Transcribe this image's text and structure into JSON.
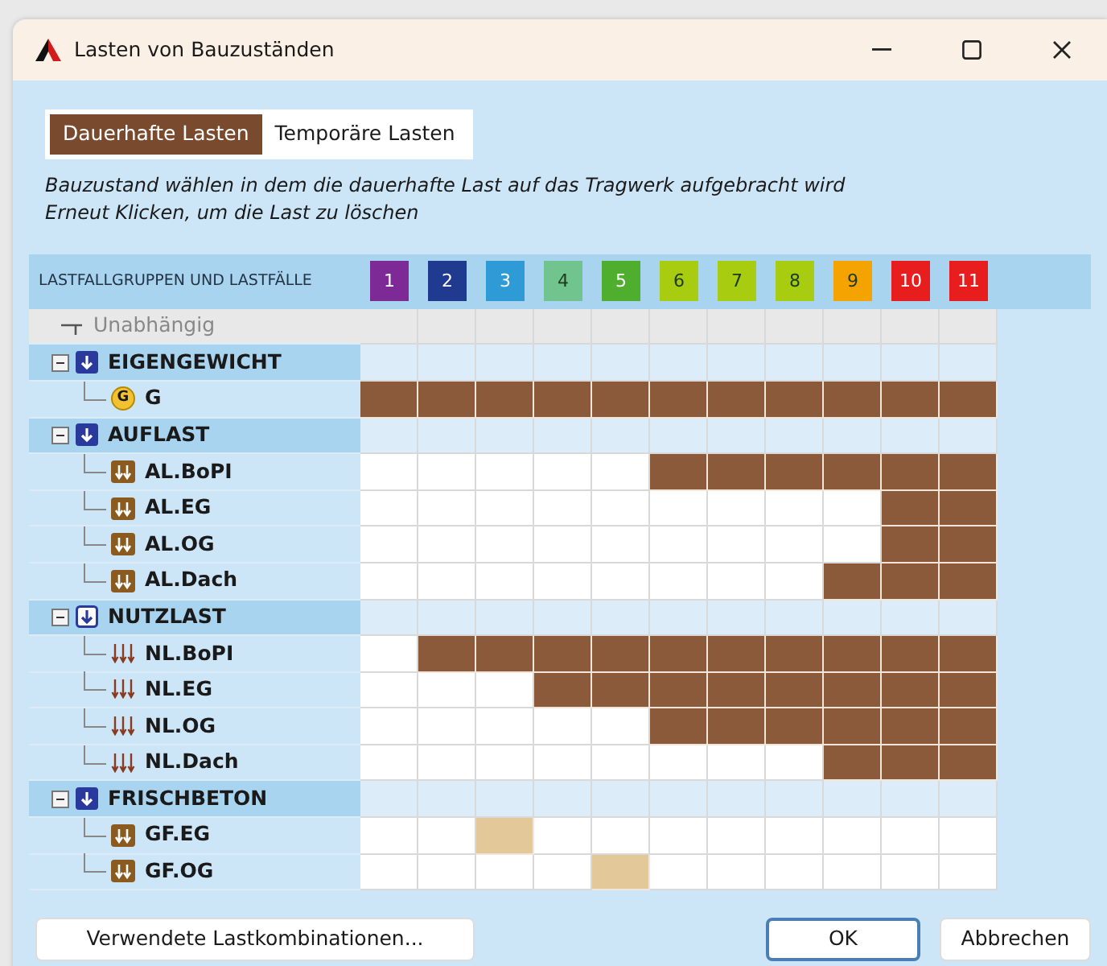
{
  "window": {
    "title": "Lasten von Bauzuständen"
  },
  "tabs": [
    {
      "label": "Dauerhafte Lasten",
      "selected": true
    },
    {
      "label": "Temporäre Lasten",
      "selected": false
    }
  ],
  "instructions": [
    "Bauzustand wählen in dem die dauerhafte Last auf das Tragwerk aufgebracht wird",
    "Erneut Klicken, um die Last zu löschen"
  ],
  "header_label": "LASTFALLGRUPPEN UND LASTFÄLLE",
  "load_cases": [
    {
      "label": "1",
      "color": "#7d2a96"
    },
    {
      "label": "2",
      "color": "#1f3a8f"
    },
    {
      "label": "3",
      "color": "#2e9bd6"
    },
    {
      "label": "4",
      "color": "#72c48e"
    },
    {
      "label": "5",
      "color": "#4fae2e"
    },
    {
      "label": "6",
      "color": "#a8cc10"
    },
    {
      "label": "7",
      "color": "#a8cc10"
    },
    {
      "label": "8",
      "color": "#a8cc10"
    },
    {
      "label": "9",
      "color": "#f5a300"
    },
    {
      "label": "10",
      "color": "#e81d1d"
    },
    {
      "label": "11",
      "color": "#e81d1d"
    }
  ],
  "tree": [
    {
      "label": "Unabhängig",
      "kind": "independent",
      "cells": [
        {
          "selected": false,
          "highlighted": false
        },
        {
          "selected": false,
          "highlighted": false
        },
        {
          "selected": false,
          "highlighted": false
        },
        {
          "selected": false,
          "highlighted": false
        },
        {
          "selected": false,
          "highlighted": false
        },
        {
          "selected": false,
          "highlighted": false
        },
        {
          "selected": false,
          "highlighted": false
        },
        {
          "selected": false,
          "highlighted": false
        },
        {
          "selected": false,
          "highlighted": false
        },
        {
          "selected": false,
          "highlighted": false
        },
        {
          "selected": false,
          "highlighted": false
        }
      ]
    },
    {
      "label": "EIGENGEWICHT",
      "kind": "permanent_group",
      "expanded": true,
      "cells": [
        {
          "selected": false,
          "highlighted": false
        },
        {
          "selected": false,
          "highlighted": false
        },
        {
          "selected": false,
          "highlighted": false
        },
        {
          "selected": false,
          "highlighted": false
        },
        {
          "selected": false,
          "highlighted": false
        },
        {
          "selected": false,
          "highlighted": false
        },
        {
          "selected": false,
          "highlighted": false
        },
        {
          "selected": false,
          "highlighted": false
        },
        {
          "selected": false,
          "highlighted": false
        },
        {
          "selected": false,
          "highlighted": false
        },
        {
          "selected": false,
          "highlighted": false
        }
      ],
      "children": [
        {
          "label": "G",
          "kind": "self_weight",
          "icon_text": "G",
          "cells": [
            {
              "selected": true,
              "highlighted": false
            },
            {
              "selected": true,
              "highlighted": false
            },
            {
              "selected": true,
              "highlighted": false
            },
            {
              "selected": true,
              "highlighted": false
            },
            {
              "selected": true,
              "highlighted": false
            },
            {
              "selected": true,
              "highlighted": false
            },
            {
              "selected": true,
              "highlighted": false
            },
            {
              "selected": true,
              "highlighted": false
            },
            {
              "selected": true,
              "highlighted": false
            },
            {
              "selected": true,
              "highlighted": false
            },
            {
              "selected": true,
              "highlighted": false
            }
          ]
        }
      ]
    },
    {
      "label": "AUFLAST",
      "kind": "permanent_group",
      "expanded": true,
      "cells": [
        {
          "selected": false,
          "highlighted": false
        },
        {
          "selected": false,
          "highlighted": false
        },
        {
          "selected": false,
          "highlighted": false
        },
        {
          "selected": false,
          "highlighted": false
        },
        {
          "selected": false,
          "highlighted": false
        },
        {
          "selected": false,
          "highlighted": false
        },
        {
          "selected": false,
          "highlighted": false
        },
        {
          "selected": false,
          "highlighted": false
        },
        {
          "selected": false,
          "highlighted": false
        },
        {
          "selected": false,
          "highlighted": false
        },
        {
          "selected": false,
          "highlighted": false
        }
      ],
      "children": [
        {
          "label": "AL.BoPI",
          "kind": "dead_load",
          "cells": [
            {
              "selected": false,
              "highlighted": false
            },
            {
              "selected": false,
              "highlighted": false
            },
            {
              "selected": false,
              "highlighted": false
            },
            {
              "selected": false,
              "highlighted": false
            },
            {
              "selected": false,
              "highlighted": false
            },
            {
              "selected": true,
              "highlighted": false
            },
            {
              "selected": true,
              "highlighted": false
            },
            {
              "selected": true,
              "highlighted": false
            },
            {
              "selected": true,
              "highlighted": false
            },
            {
              "selected": true,
              "highlighted": false
            },
            {
              "selected": true,
              "highlighted": false
            }
          ]
        },
        {
          "label": "AL.EG",
          "kind": "dead_load",
          "cells": [
            {
              "selected": false,
              "highlighted": false
            },
            {
              "selected": false,
              "highlighted": false
            },
            {
              "selected": false,
              "highlighted": false
            },
            {
              "selected": false,
              "highlighted": false
            },
            {
              "selected": false,
              "highlighted": false
            },
            {
              "selected": false,
              "highlighted": false
            },
            {
              "selected": false,
              "highlighted": false
            },
            {
              "selected": false,
              "highlighted": false
            },
            {
              "selected": false,
              "highlighted": false
            },
            {
              "selected": true,
              "highlighted": false
            },
            {
              "selected": true,
              "highlighted": false
            }
          ]
        },
        {
          "label": "AL.OG",
          "kind": "dead_load",
          "cells": [
            {
              "selected": false,
              "highlighted": false
            },
            {
              "selected": false,
              "highlighted": false
            },
            {
              "selected": false,
              "highlighted": false
            },
            {
              "selected": false,
              "highlighted": false
            },
            {
              "selected": false,
              "highlighted": false
            },
            {
              "selected": false,
              "highlighted": false
            },
            {
              "selected": false,
              "highlighted": false
            },
            {
              "selected": false,
              "highlighted": false
            },
            {
              "selected": false,
              "highlighted": false
            },
            {
              "selected": true,
              "highlighted": false
            },
            {
              "selected": true,
              "highlighted": false
            }
          ]
        },
        {
          "label": "AL.Dach",
          "kind": "dead_load",
          "cells": [
            {
              "selected": false,
              "highlighted": false
            },
            {
              "selected": false,
              "highlighted": false
            },
            {
              "selected": false,
              "highlighted": false
            },
            {
              "selected": false,
              "highlighted": false
            },
            {
              "selected": false,
              "highlighted": false
            },
            {
              "selected": false,
              "highlighted": false
            },
            {
              "selected": false,
              "highlighted": false
            },
            {
              "selected": false,
              "highlighted": false
            },
            {
              "selected": true,
              "highlighted": false
            },
            {
              "selected": true,
              "highlighted": false
            },
            {
              "selected": true,
              "highlighted": false
            }
          ]
        }
      ]
    },
    {
      "label": "NUTZLAST",
      "kind": "variable_group",
      "expanded": true,
      "cells": [
        {
          "selected": false,
          "highlighted": false
        },
        {
          "selected": false,
          "highlighted": false
        },
        {
          "selected": false,
          "highlighted": false
        },
        {
          "selected": false,
          "highlighted": false
        },
        {
          "selected": false,
          "highlighted": false
        },
        {
          "selected": false,
          "highlighted": false
        },
        {
          "selected": false,
          "highlighted": false
        },
        {
          "selected": false,
          "highlighted": false
        },
        {
          "selected": false,
          "highlighted": false
        },
        {
          "selected": false,
          "highlighted": false
        },
        {
          "selected": false,
          "highlighted": false
        }
      ],
      "children": [
        {
          "label": "NL.BoPI",
          "kind": "live_load",
          "cells": [
            {
              "selected": false,
              "highlighted": false
            },
            {
              "selected": true,
              "highlighted": false
            },
            {
              "selected": true,
              "highlighted": false
            },
            {
              "selected": true,
              "highlighted": false
            },
            {
              "selected": true,
              "highlighted": false
            },
            {
              "selected": true,
              "highlighted": false
            },
            {
              "selected": true,
              "highlighted": false
            },
            {
              "selected": true,
              "highlighted": false
            },
            {
              "selected": true,
              "highlighted": false
            },
            {
              "selected": true,
              "highlighted": false
            },
            {
              "selected": true,
              "highlighted": false
            }
          ]
        },
        {
          "label": "NL.EG",
          "kind": "live_load",
          "cells": [
            {
              "selected": false,
              "highlighted": false
            },
            {
              "selected": false,
              "highlighted": false
            },
            {
              "selected": false,
              "highlighted": false
            },
            {
              "selected": true,
              "highlighted": false
            },
            {
              "selected": true,
              "highlighted": false
            },
            {
              "selected": true,
              "highlighted": false
            },
            {
              "selected": true,
              "highlighted": false
            },
            {
              "selected": true,
              "highlighted": false
            },
            {
              "selected": true,
              "highlighted": false
            },
            {
              "selected": true,
              "highlighted": false
            },
            {
              "selected": true,
              "highlighted": false
            }
          ]
        },
        {
          "label": "NL.OG",
          "kind": "live_load",
          "cells": [
            {
              "selected": false,
              "highlighted": false
            },
            {
              "selected": false,
              "highlighted": false
            },
            {
              "selected": false,
              "highlighted": false
            },
            {
              "selected": false,
              "highlighted": false
            },
            {
              "selected": false,
              "highlighted": false
            },
            {
              "selected": true,
              "highlighted": false
            },
            {
              "selected": true,
              "highlighted": false
            },
            {
              "selected": true,
              "highlighted": false
            },
            {
              "selected": true,
              "highlighted": false
            },
            {
              "selected": true,
              "highlighted": false
            },
            {
              "selected": true,
              "highlighted": false
            }
          ]
        },
        {
          "label": "NL.Dach",
          "kind": "live_load",
          "cells": [
            {
              "selected": false,
              "highlighted": false
            },
            {
              "selected": false,
              "highlighted": false
            },
            {
              "selected": false,
              "highlighted": false
            },
            {
              "selected": false,
              "highlighted": false
            },
            {
              "selected": false,
              "highlighted": false
            },
            {
              "selected": false,
              "highlighted": false
            },
            {
              "selected": false,
              "highlighted": false
            },
            {
              "selected": false,
              "highlighted": false
            },
            {
              "selected": true,
              "highlighted": false
            },
            {
              "selected": true,
              "highlighted": false
            },
            {
              "selected": true,
              "highlighted": false
            }
          ]
        }
      ]
    },
    {
      "label": "FRISCHBETON",
      "kind": "permanent_group",
      "expanded": true,
      "cells": [
        {
          "selected": false,
          "highlighted": false
        },
        {
          "selected": false,
          "highlighted": false
        },
        {
          "selected": false,
          "highlighted": false
        },
        {
          "selected": false,
          "highlighted": false
        },
        {
          "selected": false,
          "highlighted": false
        },
        {
          "selected": false,
          "highlighted": false
        },
        {
          "selected": false,
          "highlighted": false
        },
        {
          "selected": false,
          "highlighted": false
        },
        {
          "selected": false,
          "highlighted": false
        },
        {
          "selected": false,
          "highlighted": false
        },
        {
          "selected": false,
          "highlighted": false
        }
      ],
      "children": [
        {
          "label": "GF.EG",
          "kind": "dead_load",
          "cells": [
            {
              "selected": false,
              "highlighted": false
            },
            {
              "selected": false,
              "highlighted": false
            },
            {
              "selected": false,
              "highlighted": true
            },
            {
              "selected": false,
              "highlighted": false
            },
            {
              "selected": false,
              "highlighted": false
            },
            {
              "selected": false,
              "highlighted": false
            },
            {
              "selected": false,
              "highlighted": false
            },
            {
              "selected": false,
              "highlighted": false
            },
            {
              "selected": false,
              "highlighted": false
            },
            {
              "selected": false,
              "highlighted": false
            },
            {
              "selected": false,
              "highlighted": false
            }
          ]
        },
        {
          "label": "GF.OG",
          "kind": "dead_load",
          "cells": [
            {
              "selected": false,
              "highlighted": false
            },
            {
              "selected": false,
              "highlighted": false
            },
            {
              "selected": false,
              "highlighted": false
            },
            {
              "selected": false,
              "highlighted": false
            },
            {
              "selected": false,
              "highlighted": true
            },
            {
              "selected": false,
              "highlighted": false
            },
            {
              "selected": false,
              "highlighted": false
            },
            {
              "selected": false,
              "highlighted": false
            },
            {
              "selected": false,
              "highlighted": false
            },
            {
              "selected": false,
              "highlighted": false
            },
            {
              "selected": false,
              "highlighted": false
            }
          ]
        }
      ]
    }
  ],
  "buttons": [
    {
      "label": "Verwendete Lastkombinationen...",
      "kind": "secondary"
    },
    {
      "label": "OK",
      "kind": "default"
    },
    {
      "label": "Abbrechen",
      "kind": "normal"
    }
  ]
}
